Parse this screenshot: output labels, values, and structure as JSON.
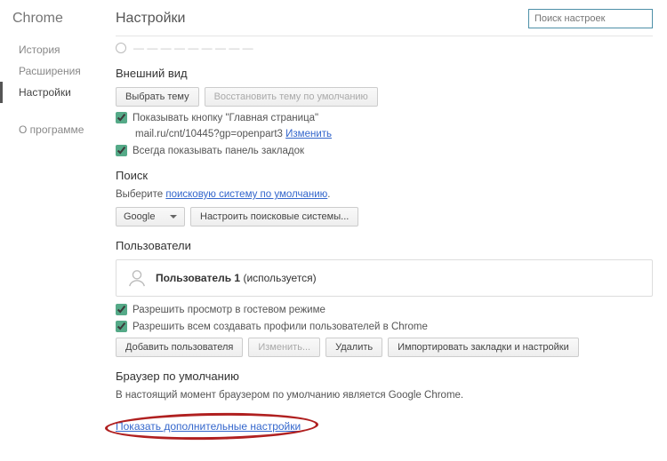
{
  "brand": "Chrome",
  "nav": {
    "history": "История",
    "extensions": "Расширения",
    "settings": "Настройки",
    "about": "О программе"
  },
  "header": {
    "title": "Настройки",
    "search_placeholder": "Поиск настроек"
  },
  "appearance": {
    "title": "Внешний вид",
    "choose_theme": "Выбрать тему",
    "restore_theme": "Восстановить тему по умолчанию",
    "show_home": "Показывать кнопку \"Главная страница\"",
    "home_value": "mail.ru/cnt/10445?gp=openpart3",
    "change": "Изменить",
    "show_bookmarks": "Всегда показывать панель закладок"
  },
  "search": {
    "title": "Поиск",
    "desc_prefix": "Выберите ",
    "desc_link": "поисковую систему по умолчанию",
    "engine": "Google",
    "manage": "Настроить поисковые системы..."
  },
  "users": {
    "title": "Пользователи",
    "user_name": "Пользователь 1",
    "user_note": "(используется)",
    "guest": "Разрешить просмотр в гостевом режиме",
    "allow_create": "Разрешить всем создавать профили пользователей в Chrome",
    "add": "Добавить пользователя",
    "edit": "Изменить...",
    "remove": "Удалить",
    "import": "Импортировать закладки и настройки"
  },
  "default_browser": {
    "title": "Браузер по умолчанию",
    "status": "В настоящий момент браузером по умолчанию является Google Chrome."
  },
  "advanced_link": "Показать дополнительные настройки"
}
